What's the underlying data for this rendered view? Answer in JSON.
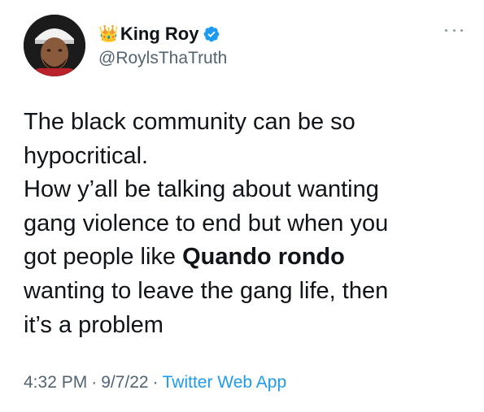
{
  "author": {
    "crown_icon": "crown-emoji",
    "display_name": "King Roy",
    "handle": "@RoylsThaTruth",
    "verified": true,
    "verified_color": "#1d9bf0"
  },
  "tweet": {
    "line1": "The black community can be so",
    "line2": "hypocritical.",
    "line3": "How y’all be talking about wanting",
    "line4": "gang violence to end but when you",
    "line5_prefix": "got people like ",
    "line5_bold": "Quando rondo",
    "line6": "wanting to leave the gang life, then",
    "line7": "it’s a problem"
  },
  "meta": {
    "time": "4:32 PM",
    "separator": "·",
    "date": "9/7/22",
    "source": "Twitter Web App"
  },
  "colors": {
    "text": "#0f1419",
    "secondary": "#536471",
    "link": "#1d9bf0"
  }
}
